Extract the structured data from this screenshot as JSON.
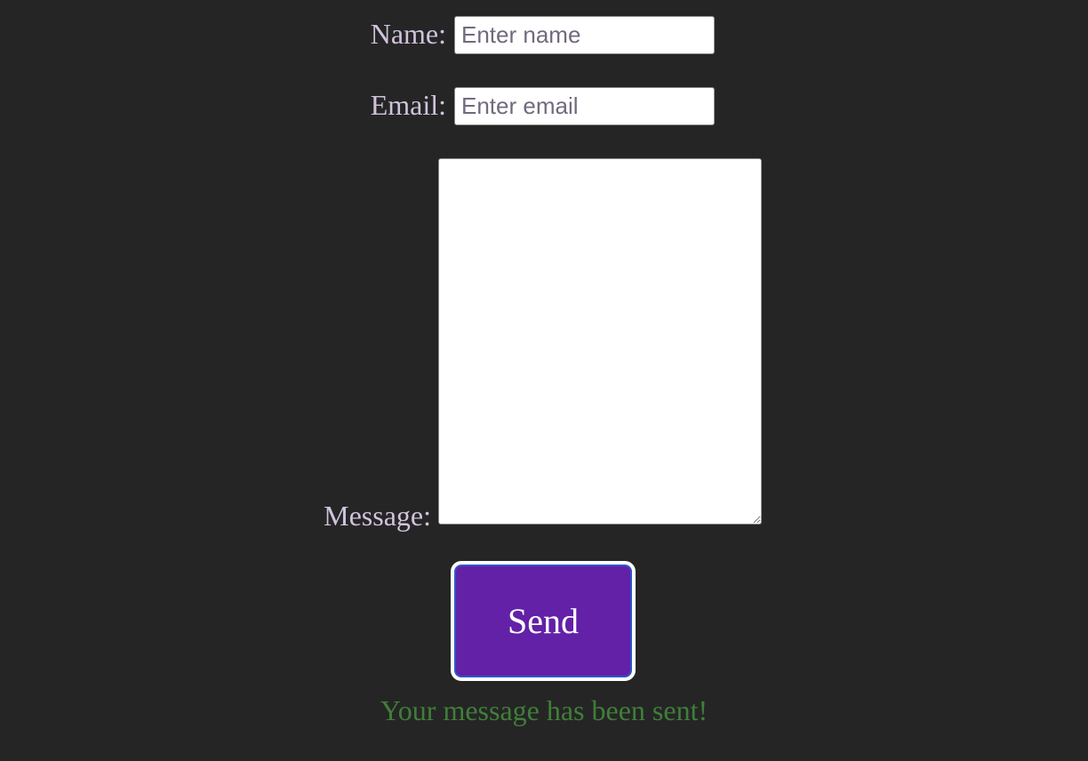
{
  "form": {
    "name_label": "Name:",
    "name_placeholder": "Enter name",
    "email_label": "Email:",
    "email_placeholder": "Enter email",
    "message_label": "Message:",
    "message_value": "",
    "send_label": "Send",
    "status_text": "Your message has been sent!"
  },
  "colors": {
    "background": "#262526",
    "label": "#cfc3dc",
    "button": "#6221a7",
    "status": "#3f7f38"
  }
}
